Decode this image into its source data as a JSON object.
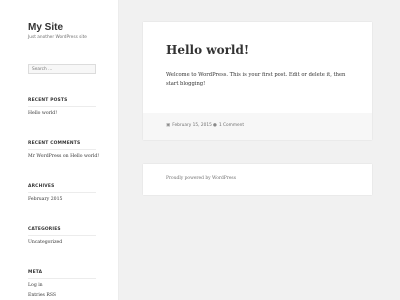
{
  "site": {
    "title": "My Site",
    "tagline": "Just another WordPress site"
  },
  "search": {
    "placeholder": "Search …"
  },
  "widgets": {
    "recent_posts": {
      "title": "RECENT POSTS",
      "items": [
        "Hello world!"
      ]
    },
    "recent_comments": {
      "title": "RECENT COMMENTS",
      "author": "Mr WordPress",
      "connector": "on",
      "post": "Hello world!"
    },
    "archives": {
      "title": "ARCHIVES",
      "items": [
        "February 2015"
      ]
    },
    "categories": {
      "title": "CATEGORIES",
      "items": [
        "Uncategorized"
      ]
    },
    "meta": {
      "title": "META",
      "items": [
        "Log in",
        "Entries RSS"
      ]
    }
  },
  "post": {
    "title": "Hello world!",
    "body": "Welcome to WordPress. This is your first post. Edit or delete it, then start blogging!",
    "date": "February 15, 2015",
    "comments": "1 Comment",
    "date_icon": "calendar-icon",
    "comment_icon": "comment-bubble-icon"
  },
  "footer": {
    "text": "Proudly powered by WordPress"
  }
}
